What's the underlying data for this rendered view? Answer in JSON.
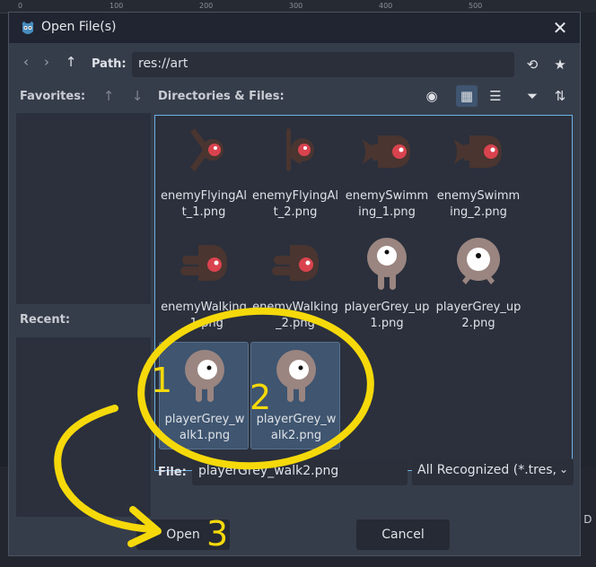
{
  "window": {
    "title": "Open File(s)",
    "close_glyph": "✕"
  },
  "background": {
    "ruler_ticks": [
      "0",
      "100",
      "200",
      "300",
      "400",
      "500"
    ],
    "cut_text": "e D"
  },
  "toolbar": {
    "back_glyph": "‹",
    "forward_glyph": "›",
    "up_glyph": "↑",
    "path_label": "Path:",
    "path_value": "res://art",
    "refresh_glyph": "⟲",
    "favorite_glyph": "★"
  },
  "favorites": {
    "label": "Favorites:",
    "up_glyph": "↑",
    "down_glyph": "↓"
  },
  "recent": {
    "label": "Recent:"
  },
  "files_header": {
    "label": "Directories & Files:",
    "eye_glyph": "◉",
    "grid_glyph": "▦",
    "list_glyph": "☰",
    "filter_glyph": "⏷",
    "sort_glyph": "⇅"
  },
  "files": [
    {
      "name": "enemyFlyingAlt_1.png",
      "thumb": "flying-1",
      "selected": false
    },
    {
      "name": "enemyFlyingAlt_2.png",
      "thumb": "flying-2",
      "selected": false
    },
    {
      "name": "enemySwimming_1.png",
      "thumb": "swimming",
      "selected": false
    },
    {
      "name": "enemySwimming_2.png",
      "thumb": "swimming",
      "selected": false
    },
    {
      "name": "enemyWalking_1.png",
      "thumb": "walking",
      "selected": false
    },
    {
      "name": "enemyWalking_2.png",
      "thumb": "walking",
      "selected": false
    },
    {
      "name": "playerGrey_up1.png",
      "thumb": "player-up1",
      "selected": false
    },
    {
      "name": "playerGrey_up2.png",
      "thumb": "player-up2",
      "selected": false
    },
    {
      "name": "playerGrey_walk1.png",
      "thumb": "player-walk",
      "selected": true
    },
    {
      "name": "playerGrey_walk2.png",
      "thumb": "player-walk",
      "selected": true
    }
  ],
  "file_field": {
    "label": "File:",
    "value": "playerGrey_walk2.png"
  },
  "filter": {
    "value": "All Recognized (*.tres,",
    "chevron": "⌄"
  },
  "buttons": {
    "open": "Open",
    "cancel": "Cancel"
  },
  "annotations": {
    "step1": "1",
    "step2": "2",
    "step3": "3",
    "color": "#f5d90a"
  },
  "colors": {
    "sprite_body": "#4a3530",
    "sprite_eye": "#d9434e",
    "player_body": "#9a8580",
    "selection": "#3f5570",
    "focus_border": "#6cb2e6"
  }
}
